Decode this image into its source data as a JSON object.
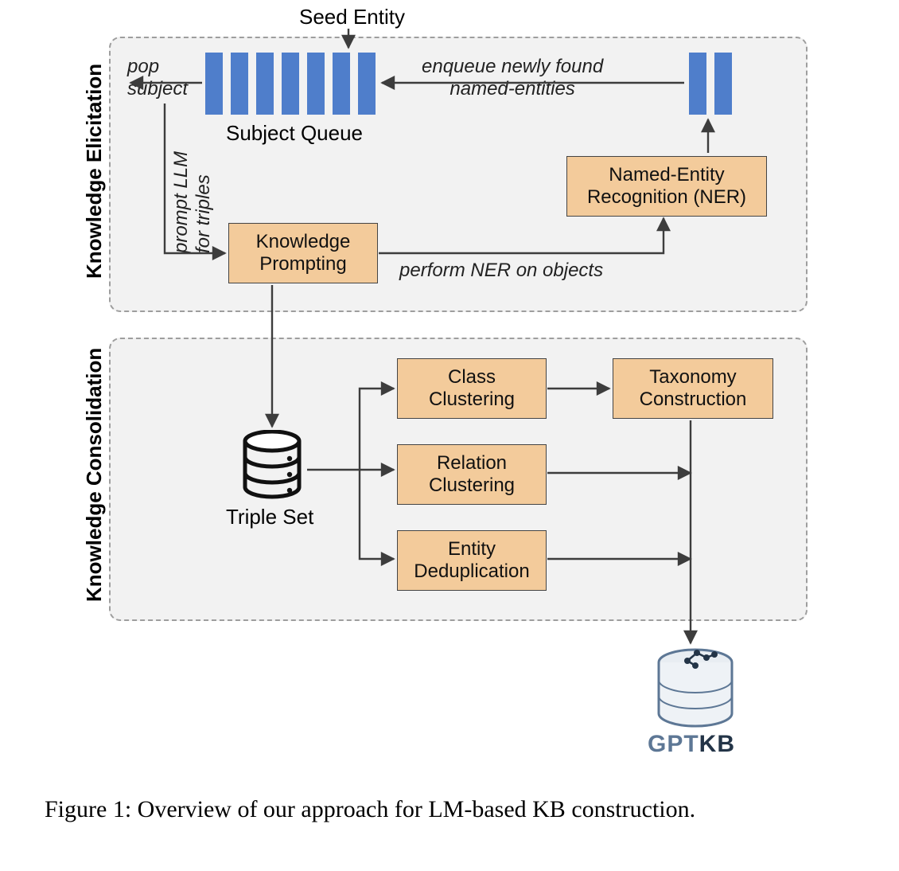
{
  "labels": {
    "seed_entity": "Seed Entity",
    "pop_subject": "pop\nsubject",
    "subject_queue": "Subject Queue",
    "enqueue": "enqueue newly found\nnamed-entities",
    "prompt_llm": "prompt LLM\nfor triples",
    "perform_ner": "perform NER on objects",
    "triple_set": "Triple Set"
  },
  "sections": {
    "elicitation": "Knowledge Elicitation",
    "consolidation": "Knowledge Consolidation"
  },
  "blocks": {
    "knowledge_prompting": "Knowledge\nPrompting",
    "ner": "Named-Entity\nRecognition (NER)",
    "class_clustering": "Class\nClustering",
    "relation_clustering": "Relation\nClustering",
    "entity_dedup": "Entity\nDeduplication",
    "taxonomy": "Taxonomy\nConstruction"
  },
  "caption": "Figure 1: Overview of our approach for LM-based KB construction.",
  "brand": {
    "left": "GPT",
    "right": "KB"
  }
}
